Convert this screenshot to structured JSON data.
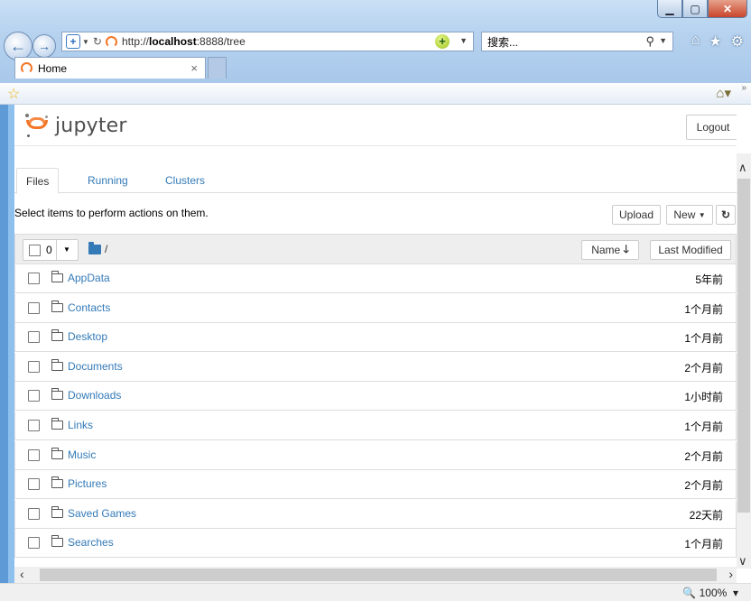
{
  "browser": {
    "address": {
      "url_prefix": "http://",
      "url_host": "localhost",
      "url_rest": ":8888/tree"
    },
    "search_placeholder": "搜索...",
    "tab_title": "Home",
    "tab_close": "×",
    "zoom": "100%"
  },
  "jupyter": {
    "logo_text": "jupyter",
    "logout_label": "Logout",
    "tabs": [
      "Files",
      "Running",
      "Clusters"
    ],
    "hint": "Select items to perform actions on them.",
    "upload_label": "Upload",
    "new_label": "New",
    "selected_count": "0",
    "breadcrumb": "/",
    "sort_name_label": "Name",
    "last_modified_label": "Last Modified",
    "items": [
      {
        "name": "AppData",
        "modified": "5年前"
      },
      {
        "name": "Contacts",
        "modified": "1个月前"
      },
      {
        "name": "Desktop",
        "modified": "1个月前"
      },
      {
        "name": "Documents",
        "modified": "2个月前"
      },
      {
        "name": "Downloads",
        "modified": "1小时前"
      },
      {
        "name": "Links",
        "modified": "1个月前"
      },
      {
        "name": "Music",
        "modified": "2个月前"
      },
      {
        "name": "Pictures",
        "modified": "2个月前"
      },
      {
        "name": "Saved Games",
        "modified": "22天前"
      },
      {
        "name": "Searches",
        "modified": "1个月前"
      }
    ]
  },
  "colors": {
    "link": "#337ab7",
    "jupyter_orange": "#f37626"
  }
}
